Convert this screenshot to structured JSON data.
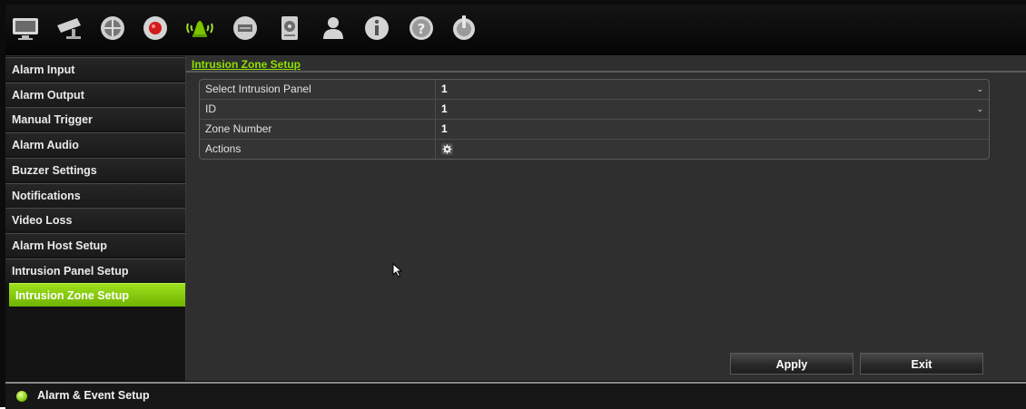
{
  "toolbar": {
    "icons": [
      "monitor-icon",
      "camera-icon",
      "network-icon",
      "record-icon",
      "alarm-icon",
      "device-icon",
      "hdd-icon",
      "user-icon",
      "info-icon",
      "help-icon",
      "power-icon"
    ]
  },
  "sidebar": {
    "items": [
      {
        "label": "Alarm Input"
      },
      {
        "label": "Alarm Output"
      },
      {
        "label": "Manual Trigger"
      },
      {
        "label": "Alarm Audio"
      },
      {
        "label": "Buzzer Settings"
      },
      {
        "label": "Notifications"
      },
      {
        "label": "Video Loss"
      },
      {
        "label": "Alarm Host Setup"
      },
      {
        "label": "Intrusion Panel Setup"
      },
      {
        "label": "Intrusion Zone Setup",
        "active": true
      }
    ]
  },
  "main": {
    "title": "Intrusion Zone Setup",
    "rows": [
      {
        "label": "Select Intrusion Panel",
        "value": "1",
        "control": "dropdown"
      },
      {
        "label": "ID",
        "value": "1",
        "control": "dropdown"
      },
      {
        "label": "Zone Number",
        "value": "1",
        "control": "text"
      },
      {
        "label": "Actions",
        "icon": "gear-icon",
        "control": "button"
      }
    ],
    "apply_label": "Apply",
    "exit_label": "Exit"
  },
  "statusbar": {
    "text": "Alarm & Event Setup"
  },
  "colors": {
    "accent": "#8ee000",
    "active_tab": "#7fc400",
    "background": "#2f2f2f"
  }
}
